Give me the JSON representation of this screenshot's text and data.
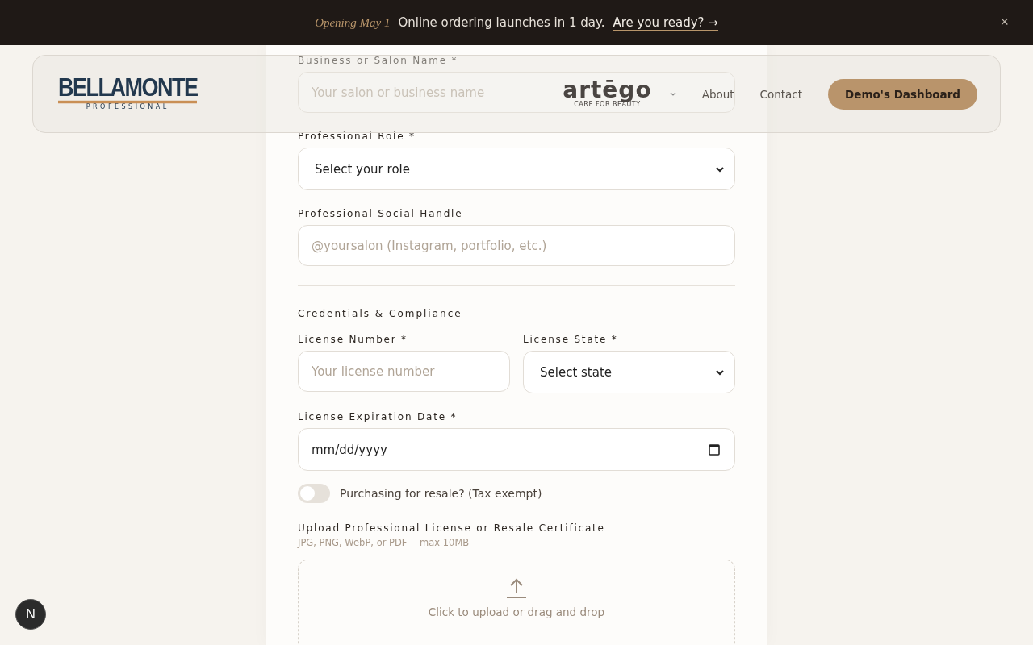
{
  "announcement": {
    "tag": "Opening May 1",
    "message": "Online ordering launches in 1 day.",
    "link": "Are you ready? →",
    "close": "×"
  },
  "header": {
    "logo": {
      "name": "BELLAMONTE",
      "sub": "PROFESSIONAL"
    },
    "brand": {
      "name": "artēgo",
      "sub": "CARE FOR BEAUTY"
    },
    "nav": [
      "About",
      "Contact"
    ],
    "cta": "Demo's Dashboard"
  },
  "form": {
    "fields": [
      {
        "kind": "input",
        "label": "Business or Salon Name *",
        "placeholder": "Your salon or business name"
      },
      {
        "kind": "select",
        "label": "Professional Role *",
        "value": "Select your role"
      },
      {
        "kind": "input",
        "label": "Professional Social Handle",
        "placeholder": "@yoursalon (Instagram, portfolio, etc.)"
      }
    ],
    "section": "Credentials & Compliance",
    "row": [
      {
        "kind": "input",
        "label": "License Number *",
        "placeholder": "Your license number"
      },
      {
        "kind": "select",
        "label": "License State *",
        "value": "Select state"
      }
    ],
    "date": {
      "kind": "date",
      "label": "License Expiration Date *",
      "value": "mm/dd/yyyy"
    },
    "toggle": {
      "label": "Purchasing for resale? (Tax exempt)",
      "on": false
    },
    "upload": {
      "label": "Upload Professional License or Resale Certificate",
      "hint": "JPG, PNG, WebP, or PDF -- max 10MB",
      "prompt": "Click to upload or drag and drop"
    }
  },
  "dev_badge": "N"
}
